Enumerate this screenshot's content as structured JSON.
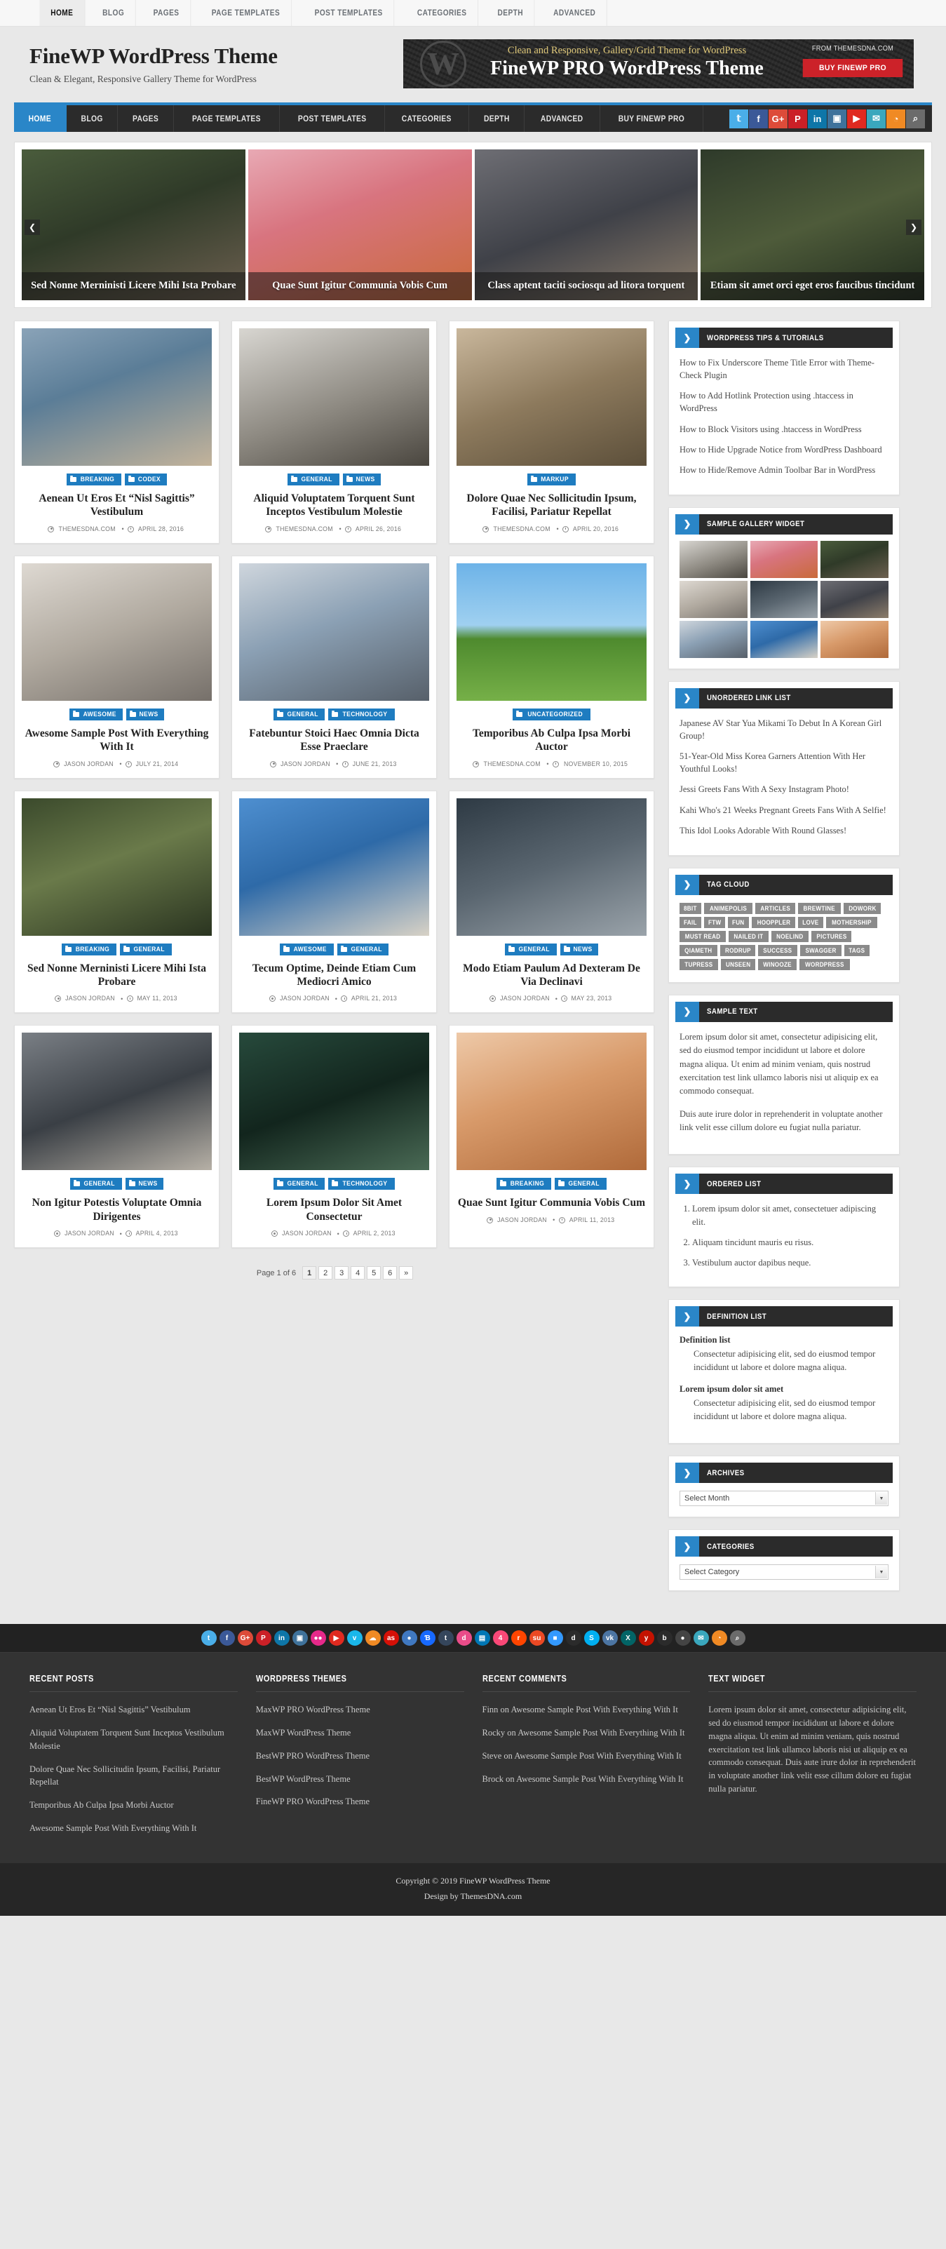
{
  "topbar": {
    "items": [
      "HOME",
      "BLOG",
      "PAGES",
      "PAGE TEMPLATES",
      "POST TEMPLATES",
      "CATEGORIES",
      "DEPTH",
      "ADVANCED"
    ],
    "active": "HOME"
  },
  "header": {
    "site_title": "FineWP WordPress Theme",
    "site_description": "Clean & Elegant, Responsive Gallery Theme for WordPress",
    "ad": {
      "tagline": "Clean and Responsive, Gallery/Grid Theme for WordPress",
      "headline": "FineWP PRO WordPress Theme",
      "from_label": "FROM THEMESDNA.COM",
      "button_label": "BUY FINEWP PRO",
      "button_color": "#cc2229",
      "logo_icon": "wordpress-icon"
    }
  },
  "mainnav": {
    "items": [
      "HOME",
      "BLOG",
      "PAGES",
      "PAGE TEMPLATES",
      "POST TEMPLATES",
      "CATEGORIES",
      "DEPTH",
      "ADVANCED",
      "BUY FINEWP PRO"
    ],
    "active": "HOME",
    "accent_color": "#2a86c8",
    "social": [
      {
        "name": "twitter-icon",
        "glyph": "𝕥",
        "label": "t",
        "color": "#4aaee8"
      },
      {
        "name": "facebook-icon",
        "glyph": "f",
        "color": "#3b5998"
      },
      {
        "name": "google-plus-icon",
        "glyph": "G+",
        "color": "#dd4b39"
      },
      {
        "name": "pinterest-icon",
        "glyph": "P",
        "color": "#cb2027"
      },
      {
        "name": "linkedin-icon",
        "glyph": "in",
        "color": "#0e76a8"
      },
      {
        "name": "instagram-icon",
        "glyph": "▣",
        "color": "#3f729b"
      },
      {
        "name": "youtube-icon",
        "glyph": "▶",
        "color": "#e02a20"
      },
      {
        "name": "email-icon",
        "glyph": "✉",
        "color": "#3aa7bd"
      },
      {
        "name": "rss-icon",
        "glyph": "◔",
        "color": "#f08a24"
      },
      {
        "name": "search-icon",
        "glyph": "⌕",
        "color": "#6b6b6b"
      }
    ]
  },
  "slider": {
    "prev_label": "❮",
    "next_label": "❯",
    "slides": [
      {
        "caption": "Sed Nonne Merninisti Licere Mihi Ista Probare",
        "ph": "ph-a"
      },
      {
        "caption": "Quae Sunt Igitur Communia Vobis Cum",
        "ph": "ph-b"
      },
      {
        "caption": "Class aptent taciti sociosqu ad litora torquent",
        "ph": "ph-c"
      },
      {
        "caption": "Etiam sit amet orci eget eros faucibus tincidunt",
        "ph": "ph-d"
      }
    ]
  },
  "posts": [
    {
      "title": "Aenean Ut Eros Et “Nisl Sagittis” Vestibulum",
      "cats": [
        "BREAKING",
        "CODEX"
      ],
      "author": "THEMESDNA.COM",
      "date": "APRIL 28, 2016",
      "ph": "ph-e"
    },
    {
      "title": "Aliquid Voluptatem Torquent Sunt Inceptos Vestibulum Molestie",
      "cats": [
        "GENERAL",
        "NEWS"
      ],
      "author": "THEMESDNA.COM",
      "date": "APRIL 26, 2016",
      "ph": "ph-f"
    },
    {
      "title": "Dolore Quae Nec Sollicitudin Ipsum, Facilisi, Pariatur Repellat",
      "cats": [
        "MARKUP"
      ],
      "author": "THEMESDNA.COM",
      "date": "APRIL 20, 2016",
      "ph": "ph-g"
    },
    {
      "title": "Awesome Sample Post With Everything With It",
      "cats": [
        "AWESOME",
        "NEWS"
      ],
      "author": "JASON JORDAN",
      "date": "JULY 21, 2014",
      "ph": "ph-h"
    },
    {
      "title": "Fatebuntur Stoici Haec Omnia Dicta Esse Praeclare",
      "cats": [
        "GENERAL",
        "TECHNOLOGY"
      ],
      "author": "JASON JORDAN",
      "date": "JUNE 21, 2013",
      "ph": "ph-i"
    },
    {
      "title": "Temporibus Ab Culpa Ipsa Morbi Auctor",
      "cats": [
        "UNCATEGORIZED"
      ],
      "author": "THEMESDNA.COM",
      "date": "NOVEMBER 10, 2015",
      "ph": "ph-j"
    },
    {
      "title": "Sed Nonne Merninisti Licere Mihi Ista Probare",
      "cats": [
        "BREAKING",
        "GENERAL"
      ],
      "author": "JASON JORDAN",
      "date": "MAY 11, 2013",
      "ph": "ph-k"
    },
    {
      "title": "Tecum Optime, Deinde Etiam Cum Mediocri Amico",
      "cats": [
        "AWESOME",
        "GENERAL"
      ],
      "author": "JASON JORDAN",
      "date": "APRIL 21, 2013",
      "ph": "ph-l"
    },
    {
      "title": "Modo Etiam Paulum Ad Dexteram De Via Declinavi",
      "cats": [
        "GENERAL",
        "NEWS"
      ],
      "author": "JASON JORDAN",
      "date": "MAY 23, 2013",
      "ph": "ph-m"
    },
    {
      "title": "Non Igitur Potestis Voluptate Omnia Dirigentes",
      "cats": [
        "GENERAL",
        "NEWS"
      ],
      "author": "JASON JORDAN",
      "date": "APRIL 4, 2013",
      "ph": "ph-n"
    },
    {
      "title": "Lorem Ipsum Dolor Sit Amet Consectetur",
      "cats": [
        "GENERAL",
        "TECHNOLOGY"
      ],
      "author": "JASON JORDAN",
      "date": "APRIL 2, 2013",
      "ph": "ph-o"
    },
    {
      "title": "Quae Sunt Igitur Communia Vobis Cum",
      "cats": [
        "BREAKING",
        "GENERAL"
      ],
      "author": "JASON JORDAN",
      "date": "APRIL 11, 2013",
      "ph": "ph-p"
    }
  ],
  "pagination": {
    "label": "Page 1 of 6",
    "pages": [
      "1",
      "2",
      "3",
      "4",
      "5",
      "6"
    ],
    "current": "1",
    "next_label": "»"
  },
  "sidebar": {
    "tips": {
      "title": "WORDPRESS TIPS & TUTORIALS",
      "links": [
        "How to Fix Underscore Theme Title Error with Theme-Check Plugin",
        "How to Add Hotlink Protection using .htaccess in WordPress",
        "How to Block Visitors using .htaccess in WordPress",
        "How to Hide Upgrade Notice from WordPress Dashboard",
        "How to Hide/Remove Admin Toolbar Bar in WordPress"
      ]
    },
    "gallery": {
      "title": "SAMPLE GALLERY WIDGET",
      "cells": [
        "ph-f",
        "ph-b",
        "ph-a",
        "ph-h",
        "ph-m",
        "ph-c",
        "ph-i",
        "ph-l",
        "ph-p"
      ]
    },
    "unordered": {
      "title": "UNORDERED LINK LIST",
      "links": [
        "Japanese AV Star Yua Mikami To Debut In A Korean Girl Group!",
        "51-Year-Old Miss Korea Garners Attention With Her Youthful Looks!",
        "Jessi Greets Fans With A Sexy Instagram Photo!",
        "Kahi Who's 21 Weeks Pregnant Greets Fans With A Selfie!",
        "This Idol Looks Adorable With Round Glasses!"
      ]
    },
    "tagcloud": {
      "title": "TAG CLOUD",
      "tags": [
        "8BIT",
        "ANIMEPOLIS",
        "ARTICLES",
        "BREWTINE",
        "DOWORK",
        "FAIL",
        "FTW",
        "FUN",
        "HOOPPLER",
        "LOVE",
        "MOTHERSHIP",
        "MUST READ",
        "NAILED IT",
        "NOELIND",
        "PICTURES",
        "QIAMETH",
        "RODRUP",
        "SUCCESS",
        "SWAGGER",
        "TAGS",
        "TUPRESS",
        "UNSEEN",
        "WINOOZE",
        "WORDPRESS"
      ]
    },
    "sampletext": {
      "title": "SAMPLE TEXT",
      "paragraphs": [
        "Lorem ipsum dolor sit amet, consectetur adipisicing elit, sed do eiusmod tempor incididunt ut labore et dolore magna aliqua. Ut enim ad minim veniam, quis nostrud exercitation test link ullamco laboris nisi ut aliquip ex ea commodo consequat.",
        "Duis aute irure dolor in reprehenderit in voluptate another link velit esse cillum dolore eu fugiat nulla pariatur."
      ]
    },
    "orderedlist": {
      "title": "ORDERED LIST",
      "items": [
        "Lorem ipsum dolor sit amet, consectetuer adipiscing elit.",
        "Aliquam tincidunt mauris eu risus.",
        "Vestibulum auctor dapibus neque."
      ]
    },
    "definitionlist": {
      "title": "DEFINITION LIST",
      "entries": [
        {
          "term": "Definition list",
          "desc": "Consectetur adipisicing elit, sed do eiusmod tempor incididunt ut labore et dolore magna aliqua."
        },
        {
          "term": "Lorem ipsum dolor sit amet",
          "desc": "Consectetur adipisicing elit, sed do eiusmod tempor incididunt ut labore et dolore magna aliqua."
        }
      ]
    },
    "archives": {
      "title": "ARCHIVES",
      "select_value": "Select Month"
    },
    "categories": {
      "title": "CATEGORIES",
      "select_value": "Select Category"
    },
    "arrow_glyph": "❯"
  },
  "footer": {
    "social": [
      {
        "name": "twitter-icon",
        "glyph": "t",
        "color": "#4aaee8"
      },
      {
        "name": "facebook-icon",
        "glyph": "f",
        "color": "#3b5998"
      },
      {
        "name": "google-plus-icon",
        "glyph": "G+",
        "color": "#dd4b39"
      },
      {
        "name": "pinterest-icon",
        "glyph": "P",
        "color": "#cb2027"
      },
      {
        "name": "linkedin-icon",
        "glyph": "in",
        "color": "#0e76a8"
      },
      {
        "name": "instagram-icon",
        "glyph": "▣",
        "color": "#3f729b"
      },
      {
        "name": "flickr-icon",
        "glyph": "●●",
        "color": "#e6298a"
      },
      {
        "name": "youtube-icon",
        "glyph": "▶",
        "color": "#e02a20"
      },
      {
        "name": "vimeo-icon",
        "glyph": "v",
        "color": "#1ab7ea"
      },
      {
        "name": "soundcloud-icon",
        "glyph": "☁",
        "color": "#f08a24"
      },
      {
        "name": "lastfm-icon",
        "glyph": "as",
        "color": "#d51007"
      },
      {
        "name": "github-icon",
        "glyph": "●",
        "color": "#4078c0"
      },
      {
        "name": "behance-icon",
        "glyph": "Ɓ",
        "color": "#1769ff"
      },
      {
        "name": "tumblr-icon",
        "glyph": "t",
        "color": "#35465c"
      },
      {
        "name": "dribbble-icon",
        "glyph": "d",
        "color": "#ea4c89"
      },
      {
        "name": "slideshare-icon",
        "glyph": "▤",
        "color": "#0077b5"
      },
      {
        "name": "foursquare-icon",
        "glyph": "4",
        "color": "#f94877"
      },
      {
        "name": "reddit-icon",
        "glyph": "r",
        "color": "#ff4500"
      },
      {
        "name": "stumbleupon-icon",
        "glyph": "su",
        "color": "#eb4924"
      },
      {
        "name": "delicious-icon",
        "glyph": "■",
        "color": "#3399ff"
      },
      {
        "name": "digg-icon",
        "glyph": "d",
        "color": "#2b2b2b"
      },
      {
        "name": "skype-icon",
        "glyph": "S",
        "color": "#00aff0"
      },
      {
        "name": "vk-icon",
        "glyph": "vk",
        "color": "#4c75a3"
      },
      {
        "name": "xing-icon",
        "glyph": "X",
        "color": "#026466"
      },
      {
        "name": "yelp-icon",
        "glyph": "y",
        "color": "#c41200"
      },
      {
        "name": "bloglovin-icon",
        "glyph": "b",
        "color": "#2b2b2b"
      },
      {
        "name": "apple-icon",
        "glyph": "●",
        "color": "#444444"
      },
      {
        "name": "envelope-icon",
        "glyph": "✉",
        "color": "#3aa7bd"
      },
      {
        "name": "rss-icon",
        "glyph": "◔",
        "color": "#f08a24"
      },
      {
        "name": "search-icon",
        "glyph": "⌕",
        "color": "#6b6b6b"
      }
    ],
    "columns": [
      {
        "title": "RECENT POSTS",
        "type": "links",
        "items": [
          "Aenean Ut Eros Et “Nisl Sagittis” Vestibulum",
          "Aliquid Voluptatem Torquent Sunt Inceptos Vestibulum Molestie",
          "Dolore Quae Nec Sollicitudin Ipsum, Facilisi, Pariatur Repellat",
          "Temporibus Ab Culpa Ipsa Morbi Auctor",
          "Awesome Sample Post With Everything With It"
        ]
      },
      {
        "title": "WORDPRESS THEMES",
        "type": "links",
        "items": [
          "MaxWP PRO WordPress Theme",
          "MaxWP WordPress Theme",
          "BestWP PRO WordPress Theme",
          "BestWP WordPress Theme",
          "FineWP PRO WordPress Theme"
        ]
      },
      {
        "title": "RECENT COMMENTS",
        "type": "links",
        "items": [
          "Finn on Awesome Sample Post With Everything With It",
          "Rocky on Awesome Sample Post With Everything With It",
          "Steve on Awesome Sample Post With Everything With It",
          "Brock on Awesome Sample Post With Everything With It"
        ]
      },
      {
        "title": "TEXT WIDGET",
        "type": "text",
        "items": [
          "Lorem ipsum dolor sit amet, consectetur adipisicing elit, sed do eiusmod tempor incididunt ut labore et dolore magna aliqua. Ut enim ad minim veniam, quis nostrud exercitation test link ullamco laboris nisi ut aliquip ex ea commodo consequat. Duis aute irure dolor in reprehenderit in voluptate another link velit esse cillum dolore eu fugiat nulla pariatur."
        ]
      }
    ],
    "copyright": "Copyright © 2019 FineWP WordPress Theme",
    "design_by": "Design by ThemesDNA.com"
  }
}
